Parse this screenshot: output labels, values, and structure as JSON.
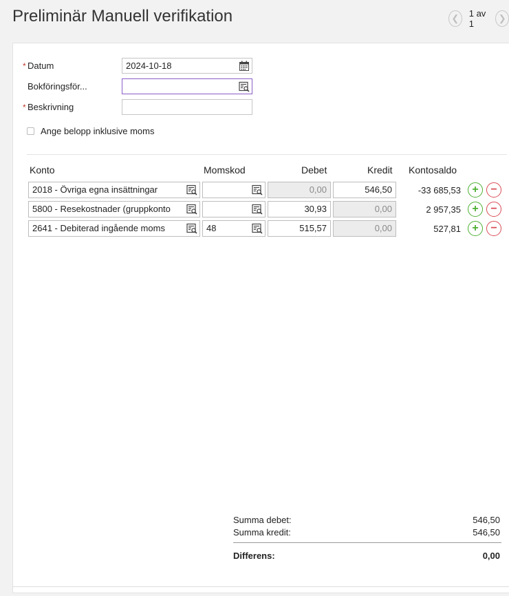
{
  "title": "Preliminär Manuell verifikation",
  "pager": {
    "text": "1 av 1"
  },
  "form": {
    "datum_label": "Datum",
    "datum_value": "2024-10-18",
    "bokforing_label": "Bokföringsför...",
    "bokforing_value": "",
    "beskrivning_label": "Beskrivning",
    "beskrivning_value": "",
    "required_mark": "*",
    "checkbox_label": "Ange belopp inklusive moms"
  },
  "table": {
    "headers": {
      "konto": "Konto",
      "momskod": "Momskod",
      "debet": "Debet",
      "kredit": "Kredit",
      "kontosaldo": "Kontosaldo"
    },
    "rows": [
      {
        "konto": "2018 - Övriga egna insättningar",
        "momskod": "",
        "debet": "0,00",
        "kredit": "546,50",
        "saldo": "-33 685,53",
        "debet_disabled": true,
        "kredit_disabled": false
      },
      {
        "konto": "5800 - Resekostnader (gruppkonto",
        "momskod": "",
        "debet": "30,93",
        "kredit": "0,00",
        "saldo": "2 957,35",
        "debet_disabled": false,
        "kredit_disabled": true
      },
      {
        "konto": "2641 - Debiterad ingående moms",
        "momskod": "48",
        "debet": "515,57",
        "kredit": "0,00",
        "saldo": "527,81",
        "debet_disabled": false,
        "kredit_disabled": true
      }
    ]
  },
  "summary": {
    "debet_label": "Summa debet:",
    "debet_value": "546,50",
    "kredit_label": "Summa kredit:",
    "kredit_value": "546,50",
    "diff_label": "Differens:",
    "diff_value": "0,00"
  },
  "colors": {
    "add": "#4caf32",
    "remove": "#d94b55",
    "focus": "#8a5cc7",
    "required": "#c0392b"
  },
  "icons": {
    "prev": "chevron-left-icon",
    "calendar": "calendar-icon",
    "lookup": "lookup-list-icon",
    "add": "plus-circle-icon",
    "remove": "minus-circle-icon"
  }
}
